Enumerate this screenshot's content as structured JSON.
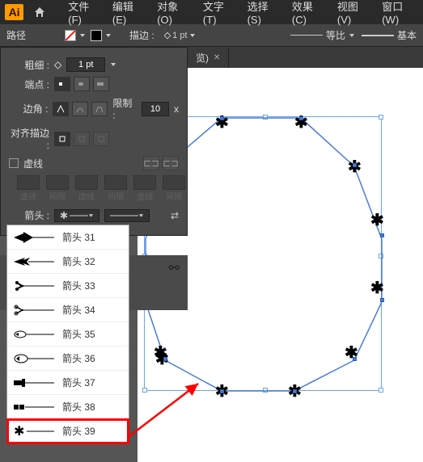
{
  "titlebar": {
    "logo": "Ai",
    "menu": [
      "文件(F)",
      "编辑(E)",
      "对象(O)",
      "文字(T)",
      "选择(S)",
      "效果(C)",
      "视图(V)",
      "窗口(W)"
    ]
  },
  "toolbar": {
    "path_label": "路径",
    "stroke_label": "描边 :",
    "stroke_weight": "1 pt",
    "ratio_label": "等比",
    "basic_label": "基本"
  },
  "panel": {
    "weight_label": "粗细 :",
    "weight_value": "1 pt",
    "caps_label": "端点 :",
    "join_label": "边角 :",
    "limit_label": "限制 :",
    "limit_value": "10",
    "limit_unit": "x",
    "align_label": "对齐描边 :",
    "dash_label": "虚线",
    "dash_headers": [
      "虚线",
      "间隔",
      "虚线",
      "间隔",
      "虚线",
      "间隔"
    ],
    "arrow_label": "箭头 :",
    "pct": "%"
  },
  "dropdown": {
    "items": [
      {
        "label": "箭头 31"
      },
      {
        "label": "箭头 32"
      },
      {
        "label": "箭头 33"
      },
      {
        "label": "箭头 34"
      },
      {
        "label": "箭头 35"
      },
      {
        "label": "箭头 36"
      },
      {
        "label": "箭头 37"
      },
      {
        "label": "箭头 38"
      },
      {
        "label": "箭头 39"
      }
    ]
  },
  "tab": {
    "label": "览)"
  }
}
